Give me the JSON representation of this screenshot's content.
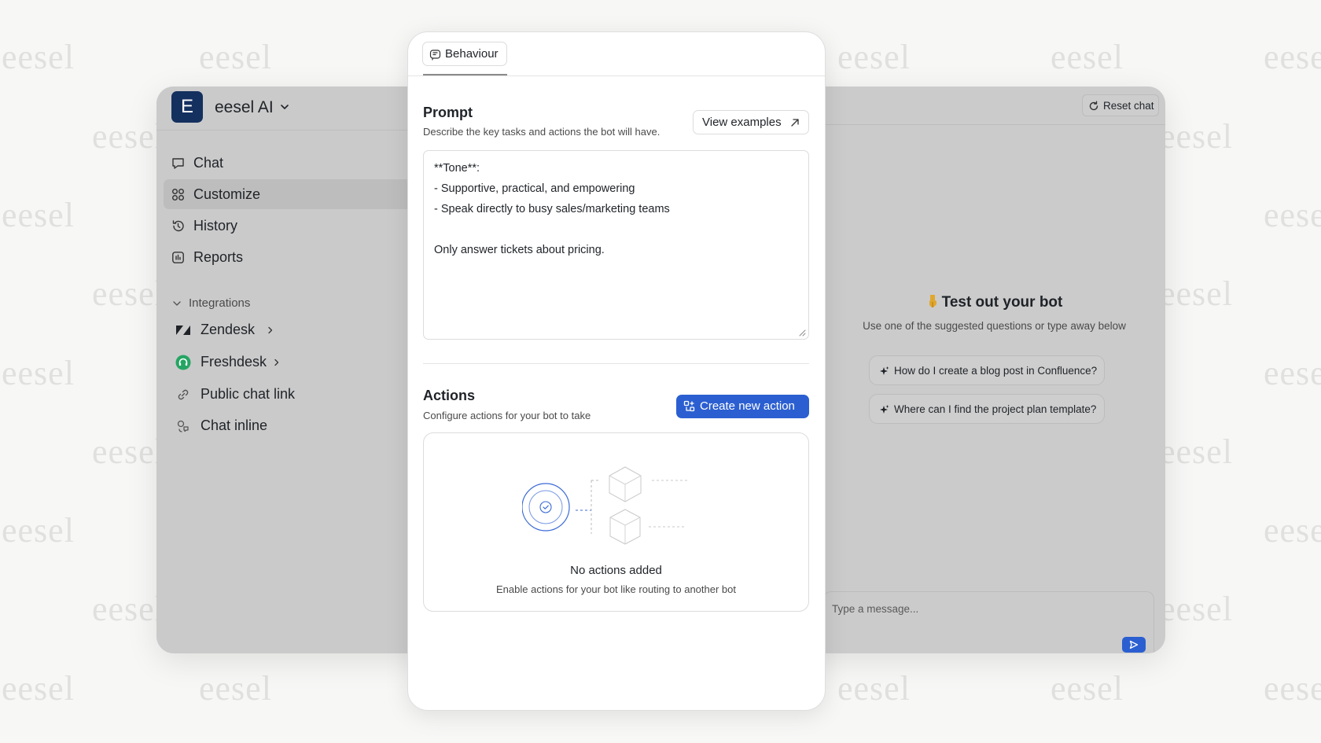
{
  "watermark": "eesel",
  "sidebar": {
    "workspace": {
      "avatar_letter": "E",
      "name": "eesel AI"
    },
    "nav": [
      {
        "label": "Chat",
        "icon": "chat-bubble-icon"
      },
      {
        "label": "Customize",
        "icon": "customize-icon",
        "active": true
      },
      {
        "label": "History",
        "icon": "history-icon"
      },
      {
        "label": "Reports",
        "icon": "reports-icon"
      }
    ],
    "integrations_heading": "Integrations",
    "integrations": [
      {
        "label": "Zendesk",
        "icon": "zendesk-icon"
      },
      {
        "label": "Freshdesk",
        "icon": "freshdesk-icon"
      },
      {
        "label": "Public chat link",
        "icon": "link-icon"
      },
      {
        "label": "Chat inline",
        "icon": "chat-inline-icon"
      }
    ]
  },
  "chat": {
    "reset_label": "Reset chat",
    "test_title": "Test out your bot",
    "test_subtitle": "Use one of the suggested questions or type away below",
    "suggestions": [
      "How do I create a blog post in Confluence?",
      "Where can I find the project plan template?"
    ],
    "input_placeholder": "Type a message..."
  },
  "panel": {
    "tab_label": "Behaviour",
    "prompt": {
      "title": "Prompt",
      "description": "Describe the key tasks and actions the bot will have.",
      "view_examples_label": "View examples",
      "value": "**Tone**:\n- Supportive, practical, and empowering\n- Speak directly to busy sales/marketing teams\n\nOnly answer tickets about pricing."
    },
    "actions": {
      "title": "Actions",
      "description": "Configure actions for your bot to take",
      "create_label": "Create new action",
      "empty_title": "No actions added",
      "empty_description": "Enable actions for your bot like routing to another bot"
    }
  },
  "colors": {
    "primary": "#2b5fd1",
    "avatar": "#14305f",
    "overlay_gray": "#cbcbcb",
    "freshdesk_green": "#25a563"
  }
}
